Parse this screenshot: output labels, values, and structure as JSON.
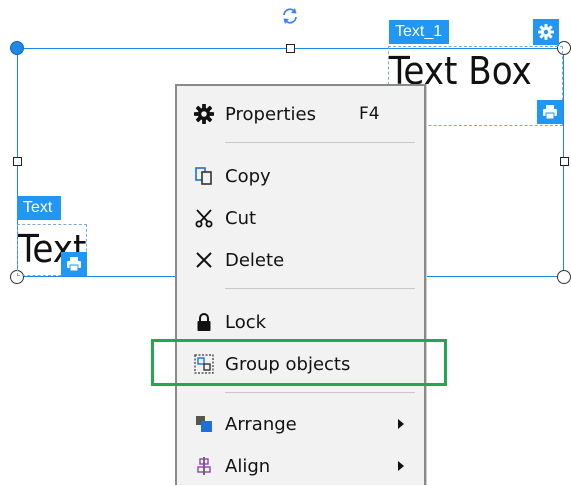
{
  "objects": {
    "text_box": {
      "tag": "Text_1",
      "content": "Text Box"
    },
    "text": {
      "tag": "Text",
      "content": "Text"
    }
  },
  "context_menu": {
    "items": [
      {
        "label": "Properties",
        "shortcut": "F4",
        "icon": "gear-icon"
      },
      {
        "label": "Copy",
        "icon": "copy-icon"
      },
      {
        "label": "Cut",
        "icon": "scissors-icon"
      },
      {
        "label": "Delete",
        "icon": "close-icon"
      },
      {
        "label": "Lock",
        "icon": "lock-icon"
      },
      {
        "label": "Group objects",
        "icon": "group-objects-icon",
        "highlighted": true
      },
      {
        "label": "Arrange",
        "icon": "arrange-icon",
        "submenu": true
      },
      {
        "label": "Align",
        "icon": "align-icon",
        "submenu": true
      }
    ]
  },
  "colors": {
    "selection": "#1e88e5",
    "tag_background": "#2196f3",
    "highlight_border": "#22a852",
    "menu_background": "#f2f2f2"
  }
}
